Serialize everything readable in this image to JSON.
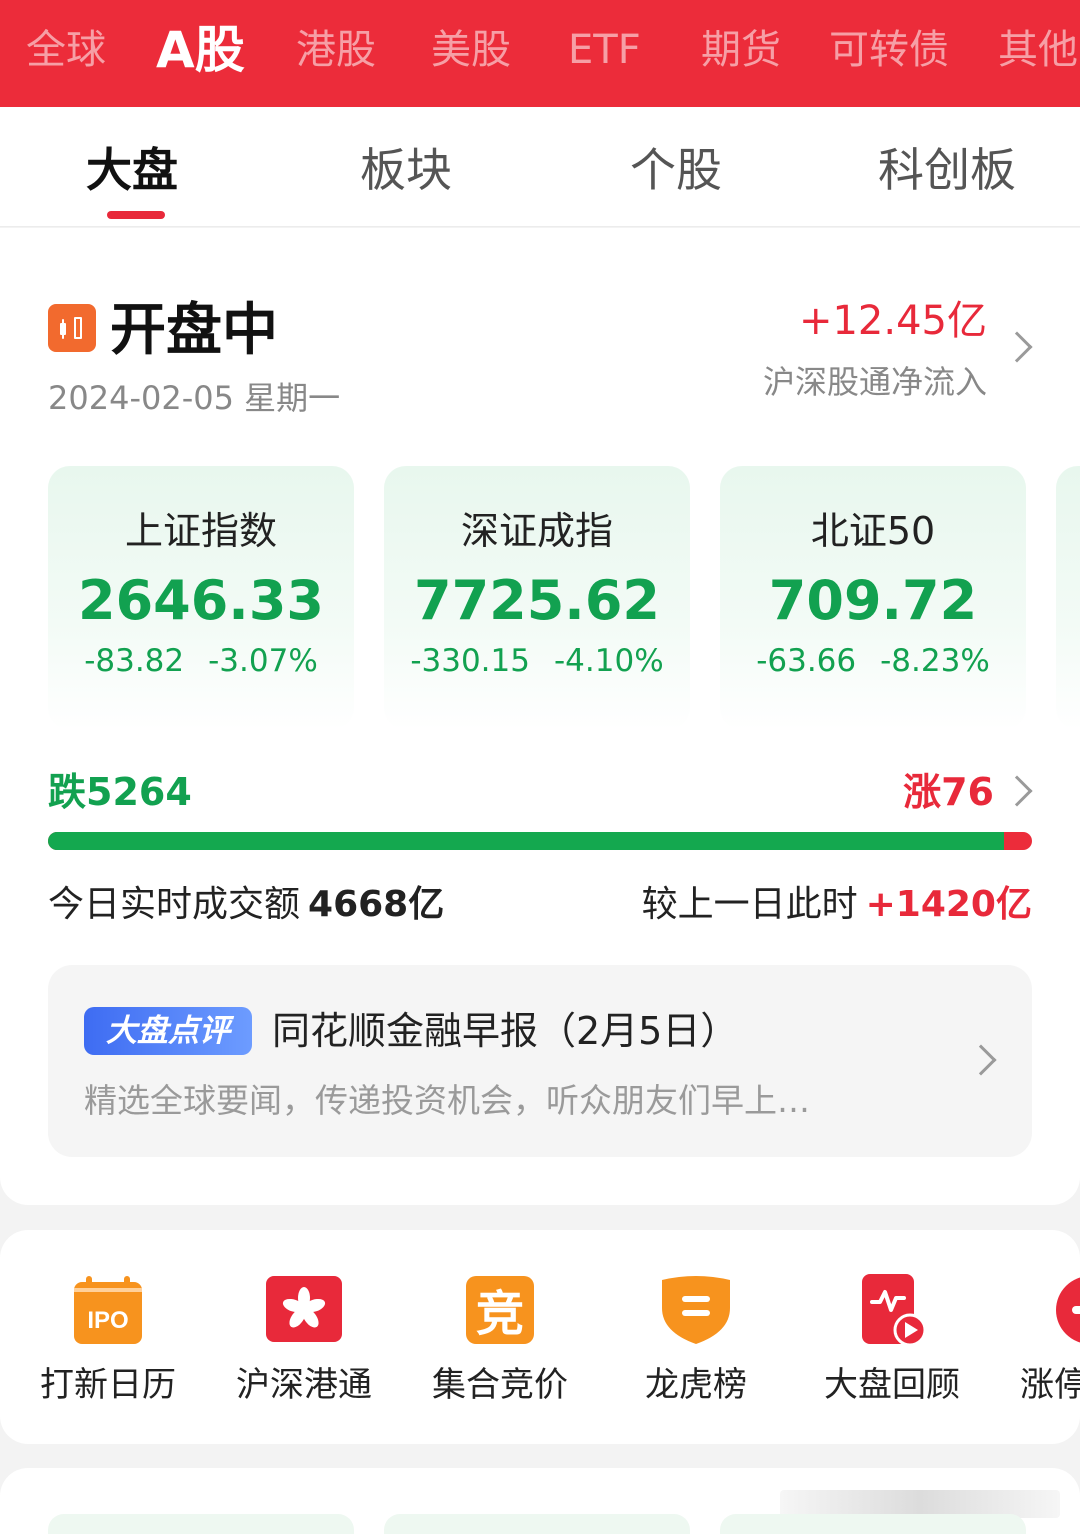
{
  "market_tabs": [
    "全球",
    "A股",
    "港股",
    "美股",
    "ETF",
    "期货",
    "可转债",
    "其他"
  ],
  "active_market": "A股",
  "sub_tabs": [
    "大盘",
    "板块",
    "个股",
    "科创板"
  ],
  "status": {
    "title": "开盘中",
    "date": "2024-02-05 星期一",
    "net_inflow_value": "+12.45亿",
    "net_inflow_label": "沪深股通净流入"
  },
  "indices": [
    {
      "name": "上证指数",
      "value": "2646.33",
      "change": "-83.82",
      "pct": "-3.07%"
    },
    {
      "name": "深证成指",
      "value": "7725.62",
      "change": "-330.15",
      "pct": "-4.10%"
    },
    {
      "name": "北证50",
      "value": "709.72",
      "change": "-63.66",
      "pct": "-8.23%"
    }
  ],
  "breadth": {
    "fall_label": "跌5264",
    "rise_label": "涨76",
    "fall_count": 5264,
    "rise_count": 76
  },
  "turnover": {
    "label": "今日实时成交额",
    "value": "4668亿",
    "compare_label": "较上一日此时",
    "compare_value": "+1420亿"
  },
  "commentary": {
    "badge": "大盘点评",
    "title": "同花顺金融早报（2月5日）",
    "subtitle": "精选全球要闻，传递投资机会，听众朋友们早上…"
  },
  "tools": [
    {
      "label": "打新日历",
      "icon": "ipo-calendar-icon"
    },
    {
      "label": "沪深港通",
      "icon": "hong-kong-flag-icon"
    },
    {
      "label": "集合竞价",
      "icon": "auction-icon"
    },
    {
      "label": "龙虎榜",
      "icon": "shield-icon"
    },
    {
      "label": "大盘回顾",
      "icon": "market-review-video-icon"
    },
    {
      "label": "涨停",
      "icon": "limit-up-icon"
    }
  ],
  "colors": {
    "brand_red": "#ec2c3a",
    "rise_red": "#e8293a",
    "fall_green": "#12a150",
    "accent_blue": "#3e6cf2",
    "icon_orange": "#f7931e"
  }
}
